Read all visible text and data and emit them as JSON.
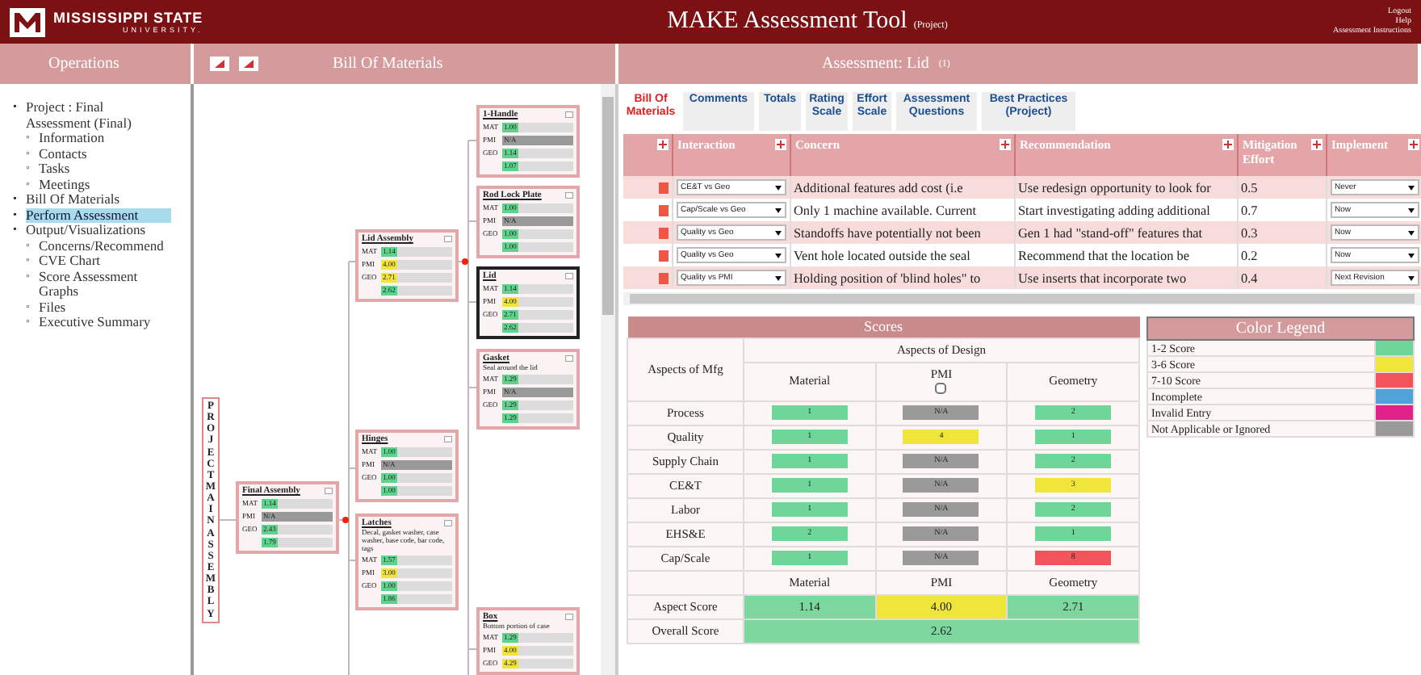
{
  "header": {
    "logo_name": "MISSISSIPPI STATE",
    "logo_sub": "UNIVERSITY.",
    "title": "MAKE Assessment Tool",
    "title_note": "(Project)",
    "links": [
      "Logout",
      "Help",
      "Assessment Instructions"
    ]
  },
  "panels": {
    "left": "Operations",
    "middle": "Bill Of Materials",
    "right": "Assessment: Lid",
    "right_note": "(1)"
  },
  "sidebar": {
    "items": [
      {
        "bullet": "•",
        "label": "Project : Final Assessment (Final)",
        "selected": false,
        "children": [
          {
            "bullet": "◦",
            "label": "Information",
            "selected": false
          },
          {
            "bullet": "◦",
            "label": "Contacts",
            "selected": false
          },
          {
            "bullet": "◦",
            "label": "Tasks",
            "selected": false
          },
          {
            "bullet": "◦",
            "label": "Meetings",
            "selected": false
          }
        ]
      },
      {
        "bullet": "•",
        "label": "Bill Of Materials",
        "selected": false
      },
      {
        "bullet": "•",
        "label": "Perform Assessment",
        "selected": true
      },
      {
        "bullet": "•",
        "label": "Output/Visualizations",
        "selected": false,
        "children": [
          {
            "bullet": "◦",
            "label": "Concerns/Recommend",
            "selected": false
          },
          {
            "bullet": "◦",
            "label": "CVE Chart",
            "selected": false
          },
          {
            "bullet": "◦",
            "label": "Score Assessment Graphs",
            "selected": false
          },
          {
            "bullet": "◦",
            "label": "Files",
            "selected": false
          },
          {
            "bullet": "◦",
            "label": "Executive Summary",
            "selected": false
          }
        ]
      }
    ]
  },
  "tree": {
    "root_label": "PROJECT MAIN ASSEMBLY",
    "nodes": [
      {
        "title": "Final Assembly",
        "selected": false,
        "scores": [
          {
            "label": "MAT",
            "value": "1.14",
            "kind": "value",
            "color": "#5fd38d"
          },
          {
            "label": "PMI",
            "value": "N/A",
            "kind": "na",
            "color": "#9a9a9a"
          },
          {
            "label": "GEO",
            "value": "2.43",
            "kind": "value",
            "color": "#5fd38d"
          },
          {
            "value": "1.79",
            "kind": "value",
            "color": "#5fd38d"
          }
        ]
      },
      {
        "title": "Lid Assembly",
        "selected": false,
        "scores": [
          {
            "label": "MAT",
            "value": "1.14",
            "kind": "value",
            "color": "#5fd38d"
          },
          {
            "label": "PMI",
            "value": "4.00",
            "kind": "value",
            "color": "#f0e53a"
          },
          {
            "label": "GEO",
            "value": "2.71",
            "kind": "value",
            "color": "#f0e53a"
          },
          {
            "value": "2.62",
            "kind": "value",
            "color": "#5fd38d"
          }
        ]
      },
      {
        "title": "Hinges",
        "selected": false,
        "scores": [
          {
            "label": "MAT",
            "value": "1.00",
            "kind": "value",
            "color": "#5fd38d"
          },
          {
            "label": "PMI",
            "value": "N/A",
            "kind": "na",
            "color": "#9a9a9a"
          },
          {
            "label": "GEO",
            "value": "1.00",
            "kind": "value",
            "color": "#5fd38d"
          },
          {
            "value": "1.00",
            "kind": "value",
            "color": "#5fd38d"
          }
        ]
      },
      {
        "title": "Latches",
        "desc": "Decal, gasket washer, case washer, base code, bar code, tags",
        "selected": false,
        "scores": [
          {
            "label": "MAT",
            "value": "1.57",
            "kind": "value",
            "color": "#5fd38d"
          },
          {
            "label": "PMI",
            "value": "3.00",
            "kind": "value",
            "color": "#f0e53a"
          },
          {
            "label": "GEO",
            "value": "1.00",
            "kind": "value",
            "color": "#5fd38d"
          },
          {
            "value": "1.86",
            "kind": "value",
            "color": "#5fd38d"
          }
        ]
      },
      {
        "title": "1-Handle",
        "selected": false,
        "scores": [
          {
            "label": "MAT",
            "value": "1.00",
            "kind": "value",
            "color": "#5fd38d"
          },
          {
            "label": "PMI",
            "value": "N/A",
            "kind": "na",
            "color": "#9a9a9a"
          },
          {
            "label": "GEO",
            "value": "1.14",
            "kind": "value",
            "color": "#5fd38d"
          },
          {
            "value": "1.07",
            "kind": "value",
            "color": "#5fd38d"
          }
        ]
      },
      {
        "title": "Rod Lock Plate",
        "selected": false,
        "scores": [
          {
            "label": "MAT",
            "value": "1.00",
            "kind": "value",
            "color": "#5fd38d"
          },
          {
            "label": "PMI",
            "value": "N/A",
            "kind": "na",
            "color": "#9a9a9a"
          },
          {
            "label": "GEO",
            "value": "1.00",
            "kind": "value",
            "color": "#5fd38d"
          },
          {
            "value": "1.00",
            "kind": "value",
            "color": "#5fd38d"
          }
        ]
      },
      {
        "title": "Lid",
        "selected": true,
        "scores": [
          {
            "label": "MAT",
            "value": "1.14",
            "kind": "value",
            "color": "#5fd38d"
          },
          {
            "label": "PMI",
            "value": "4.00",
            "kind": "value",
            "color": "#f0e53a"
          },
          {
            "label": "GEO",
            "value": "2.71",
            "kind": "value",
            "color": "#5fd38d"
          },
          {
            "value": "2.62",
            "kind": "value",
            "color": "#5fd38d"
          }
        ]
      },
      {
        "title": "Gasket",
        "desc": "Seal around the lid",
        "selected": false,
        "scores": [
          {
            "label": "MAT",
            "value": "1.29",
            "kind": "value",
            "color": "#5fd38d"
          },
          {
            "label": "PMI",
            "value": "N/A",
            "kind": "na",
            "color": "#9a9a9a"
          },
          {
            "label": "GEO",
            "value": "1.29",
            "kind": "value",
            "color": "#5fd38d"
          },
          {
            "value": "1.29",
            "kind": "value",
            "color": "#5fd38d"
          }
        ]
      },
      {
        "title": "Box",
        "desc": "Bottom portion of case",
        "selected": false,
        "scores": [
          {
            "label": "MAT",
            "value": "1.29",
            "kind": "value",
            "color": "#5fd38d"
          },
          {
            "label": "PMI",
            "value": "4.00",
            "kind": "value",
            "color": "#f0e53a"
          },
          {
            "label": "GEO",
            "value": "4.29",
            "kind": "value",
            "color": "#f0e53a"
          }
        ]
      }
    ]
  },
  "tabs": [
    {
      "label": "Bill Of Materials",
      "selected": true
    },
    {
      "label": "Comments",
      "selected": false
    },
    {
      "label": "Totals",
      "selected": false
    },
    {
      "label": "Rating Scale",
      "selected": false
    },
    {
      "label": "Effort Scale",
      "selected": false
    },
    {
      "label": "Assessment Questions",
      "selected": false
    },
    {
      "label": "Best Practices (Project)",
      "selected": false
    }
  ],
  "concerns": {
    "columns": [
      "Interaction",
      "Concern",
      "Recommendation",
      "Mitigation Effort",
      "Implement"
    ],
    "rows": [
      {
        "interaction": "CE&T vs Geo",
        "concern": "Additional features add cost (i.e",
        "recommendation": "Use redesign opportunity to look for",
        "effort": "0.5",
        "implement": "Never"
      },
      {
        "interaction": "Cap/Scale vs Geo",
        "concern": "Only 1 machine available. Current",
        "recommendation": "Start investigating adding additional",
        "effort": "0.7",
        "implement": "Now"
      },
      {
        "interaction": "Quality vs Geo",
        "concern": "Standoffs have potentially not been",
        "recommendation": "Gen 1 had \"stand-off\" features that",
        "effort": "0.3",
        "implement": "Now"
      },
      {
        "interaction": "Quality vs Geo",
        "concern": "Vent hole located outside the seal",
        "recommendation": "Recommend that the location be",
        "effort": "0.2",
        "implement": "Now"
      },
      {
        "interaction": "Quality vs PMI",
        "concern": "Holding position of 'blind holes\" to",
        "recommendation": "Use inserts that incorporate two",
        "effort": "0.4",
        "implement": "Next Revision"
      }
    ]
  },
  "scores": {
    "title": "Scores",
    "corner": "Aspects of Mfg",
    "group": "Aspects of Design",
    "columns": [
      {
        "label": "Material"
      },
      {
        "label": "PMI",
        "checked": false
      },
      {
        "label": "Geometry"
      }
    ],
    "rows": [
      {
        "label": "Process",
        "cells": [
          {
            "value": "1",
            "color": "#6fd69a"
          },
          {
            "value": "N/A",
            "color": "#9a9a9a"
          },
          {
            "value": "2",
            "color": "#6fd69a"
          }
        ]
      },
      {
        "label": "Quality",
        "cells": [
          {
            "value": "1",
            "color": "#6fd69a"
          },
          {
            "value": "4",
            "color": "#f0e53a"
          },
          {
            "value": "1",
            "color": "#6fd69a"
          }
        ]
      },
      {
        "label": "Supply Chain",
        "cells": [
          {
            "value": "1",
            "color": "#6fd69a"
          },
          {
            "value": "N/A",
            "color": "#9a9a9a"
          },
          {
            "value": "2",
            "color": "#6fd69a"
          }
        ]
      },
      {
        "label": "CE&T",
        "cells": [
          {
            "value": "1",
            "color": "#6fd69a"
          },
          {
            "value": "N/A",
            "color": "#9a9a9a"
          },
          {
            "value": "3",
            "color": "#f0e53a"
          }
        ]
      },
      {
        "label": "Labor",
        "cells": [
          {
            "value": "1",
            "color": "#6fd69a"
          },
          {
            "value": "N/A",
            "color": "#9a9a9a"
          },
          {
            "value": "2",
            "color": "#6fd69a"
          }
        ]
      },
      {
        "label": "EHS&E",
        "cells": [
          {
            "value": "2",
            "color": "#6fd69a"
          },
          {
            "value": "N/A",
            "color": "#9a9a9a"
          },
          {
            "value": "1",
            "color": "#6fd69a"
          }
        ]
      },
      {
        "label": "Cap/Scale",
        "cells": [
          {
            "value": "1",
            "color": "#6fd69a"
          },
          {
            "value": "N/A",
            "color": "#9a9a9a"
          },
          {
            "value": "8",
            "color": "#f2545b"
          }
        ]
      }
    ],
    "footer_columns": [
      "Material",
      "PMI",
      "Geometry"
    ],
    "aspect_label": "Aspect Score",
    "aspect": [
      {
        "value": "1.14",
        "color": "#7cd89e"
      },
      {
        "value": "4.00",
        "color": "#f0e53a"
      },
      {
        "value": "2.71",
        "color": "#7cd89e"
      }
    ],
    "overall_label": "Overall Score",
    "overall": {
      "value": "2.62",
      "color": "#7cd89e"
    }
  },
  "legend": {
    "title": "Color Legend",
    "items": [
      {
        "label": "1-2 Score",
        "color": "#6fd69a"
      },
      {
        "label": "3-6 Score",
        "color": "#f0e53a"
      },
      {
        "label": "7-10 Score",
        "color": "#f2545b"
      },
      {
        "label": "Incomplete",
        "color": "#4fa3d9"
      },
      {
        "label": "Invalid Entry",
        "color": "#e0218a"
      },
      {
        "label": "Not Applicable or Ignored",
        "color": "#9a9a9a"
      }
    ]
  }
}
